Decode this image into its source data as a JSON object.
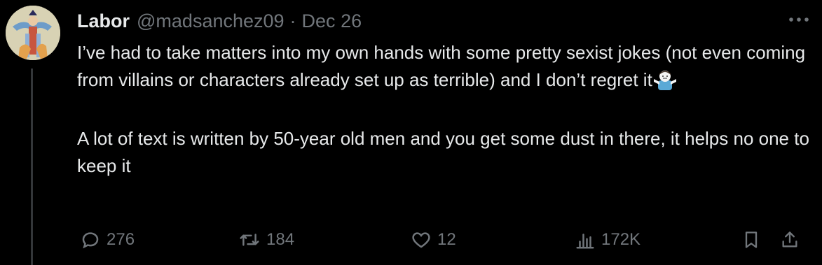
{
  "author": {
    "name": "Labor",
    "handle": "@madsanchez09",
    "separator": "·",
    "date": "Dec 26"
  },
  "more_icon": "more-horizontal-icon",
  "text": {
    "paragraph_1": "I’ve had to take matters into my own hands with some pretty sexist jokes (not even coming from villains or characters already set up as terrible) and I don’t regret it",
    "emoji": "man-shrugging-emoji",
    "paragraph_2": "A lot of text is written by 50-year old men and you get some dust in there, it helps no one to keep it"
  },
  "actions": {
    "replies": "276",
    "reposts": "184",
    "likes": "12",
    "views": "172K"
  },
  "colors": {
    "background": "#000000",
    "text": "#e7e9ea",
    "muted": "#71767b",
    "thread_line": "#333639"
  }
}
